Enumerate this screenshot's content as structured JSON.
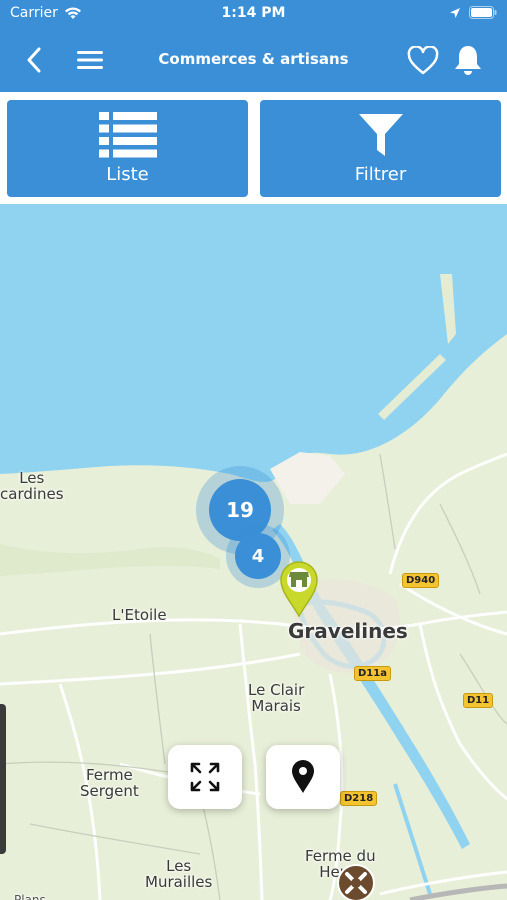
{
  "status": {
    "carrier": "Carrier",
    "time": "1:14 PM"
  },
  "nav": {
    "title": "Commerces & artisans"
  },
  "tabs": [
    {
      "label": "Liste"
    },
    {
      "label": "Filtrer"
    }
  ],
  "map": {
    "labels": {
      "les_picardines": "Les\ncardines",
      "letoile": "L'Etoile",
      "gravelines": "Gravelines",
      "le_clair_marais": "Le Clair\nMarais",
      "ferme_sergent": "Ferme\nSergent",
      "les_murailles": "Les\nMurailles",
      "ferme_du_heurt": "Ferme du\nHeurt",
      "plans": "Plans"
    },
    "roads": {
      "d940": "D940",
      "d11a": "D11a",
      "d11": "D11",
      "d218": "D218"
    },
    "clusters": {
      "big": "19",
      "small": "4"
    }
  },
  "colors": {
    "primary": "#3a8fd6",
    "sea": "#8fd3f0",
    "land": "#e8efd8",
    "cluster": "#3a8fd6",
    "marker": "#c9d92b"
  }
}
